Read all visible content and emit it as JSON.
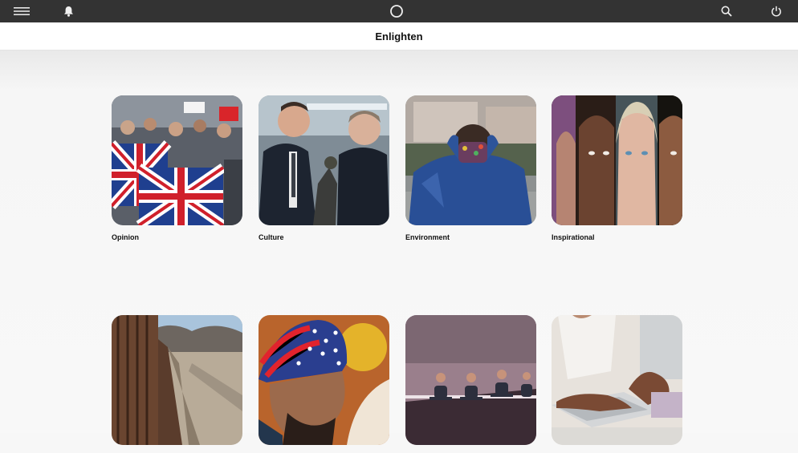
{
  "header": {
    "menu_icon": "hamburger-menu-icon",
    "notification_icon": "bell-icon",
    "home_icon": "circle-home-icon",
    "search_icon": "search-icon",
    "power_icon": "power-icon"
  },
  "page": {
    "title": "Enlighten"
  },
  "categories": [
    {
      "label": "Opinion"
    },
    {
      "label": "Culture"
    },
    {
      "label": "Environment"
    },
    {
      "label": "Inspirational"
    },
    {
      "label": ""
    },
    {
      "label": ""
    },
    {
      "label": ""
    },
    {
      "label": ""
    }
  ],
  "colors": {
    "topbar": "#333333",
    "title_bg": "#ffffff",
    "page_bg": "#f7f7f7"
  }
}
